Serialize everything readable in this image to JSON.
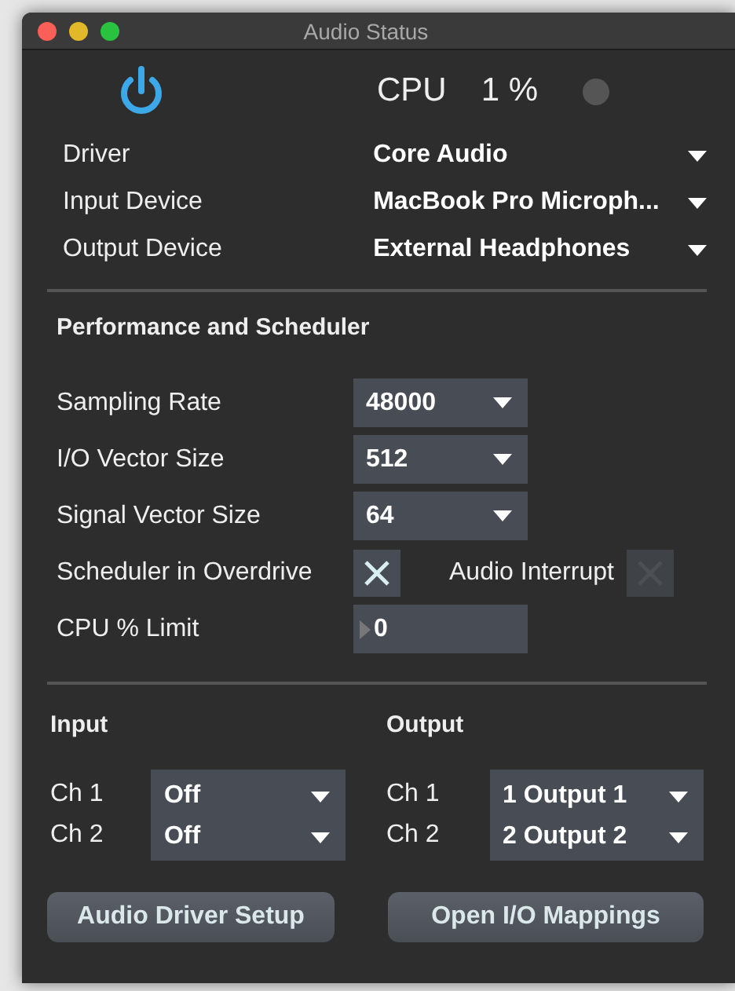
{
  "window": {
    "title": "Audio Status"
  },
  "power": {
    "on": true
  },
  "cpu": {
    "label": "CPU",
    "reading": "1 %"
  },
  "devices": [
    {
      "label": "Driver",
      "value": "Core Audio"
    },
    {
      "label": "Input Device",
      "value": "MacBook Pro Microph..."
    },
    {
      "label": "Output Device",
      "value": "External Headphones"
    }
  ],
  "performance": {
    "heading": "Performance and Scheduler",
    "rows": [
      {
        "kind": "dropdown",
        "label": "Sampling Rate",
        "value": "48000"
      },
      {
        "kind": "dropdown",
        "label": "I/O Vector Size",
        "value": "512"
      },
      {
        "kind": "dropdown",
        "label": "Signal Vector Size",
        "value": "64"
      },
      {
        "kind": "checkboxes",
        "label": "Scheduler in Overdrive",
        "checked": true,
        "second_label": "Audio Interrupt",
        "second_disabled": true
      },
      {
        "kind": "number",
        "label": "CPU % Limit",
        "value": "0"
      }
    ]
  },
  "input": {
    "heading": "Input",
    "channels": [
      {
        "label": "Ch 1",
        "value": "Off"
      },
      {
        "label": "Ch 2",
        "value": "Off"
      }
    ]
  },
  "output": {
    "heading": "Output",
    "channels": [
      {
        "label": "Ch 1",
        "value": "1 Output 1"
      },
      {
        "label": "Ch 2",
        "value": "2 Output 2"
      }
    ]
  },
  "buttons": [
    "Audio Driver Setup",
    "Open I/O Mappings"
  ]
}
